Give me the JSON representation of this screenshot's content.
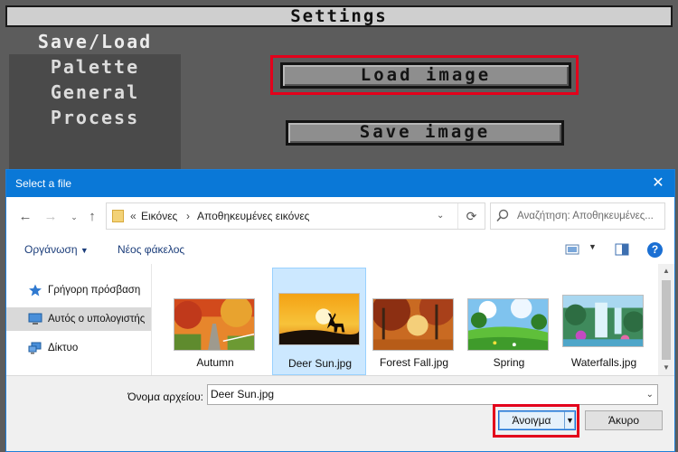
{
  "app": {
    "title": "Settings",
    "menu": [
      {
        "label": "Save/Load",
        "active": true
      },
      {
        "label": "Palette",
        "active": false
      },
      {
        "label": "General",
        "active": false
      },
      {
        "label": "Process",
        "active": false
      }
    ],
    "load_button_label": "Load image",
    "save_button_label": "Save image",
    "highlight_color": "#e3001b"
  },
  "dialog": {
    "title": "Select a file",
    "close_icon": "close-icon",
    "address": {
      "prefix": "«",
      "crumbs": [
        "Εικόνες",
        "Αποθηκευμένες εικόνες"
      ],
      "separator": "›"
    },
    "search_placeholder": "Αναζήτηση: Αποθηκευμένες...",
    "toolbar": {
      "organize_label": "Οργάνωση",
      "new_folder_label": "Νέος φάκελος"
    },
    "nav": [
      {
        "label": "Γρήγορη πρόσβαση",
        "icon": "star-icon",
        "selected": false
      },
      {
        "label": "Αυτός ο υπολογιστής",
        "icon": "computer-icon",
        "selected": true
      },
      {
        "label": "Δίκτυο",
        "icon": "network-icon",
        "selected": false
      }
    ],
    "files": [
      {
        "name": "Autumn",
        "selected": false
      },
      {
        "name": "Deer Sun.jpg",
        "selected": true
      },
      {
        "name": "Forest Fall.jpg",
        "selected": false
      },
      {
        "name": "Spring",
        "selected": false
      },
      {
        "name": "Waterfalls.jpg",
        "selected": false
      }
    ],
    "filename_label": "Όνομα αρχείου:",
    "filename_value": "Deer Sun.jpg",
    "open_label": "Άνοιγμα",
    "cancel_label": "Άκυρο",
    "accent_color": "#0a78d7"
  }
}
